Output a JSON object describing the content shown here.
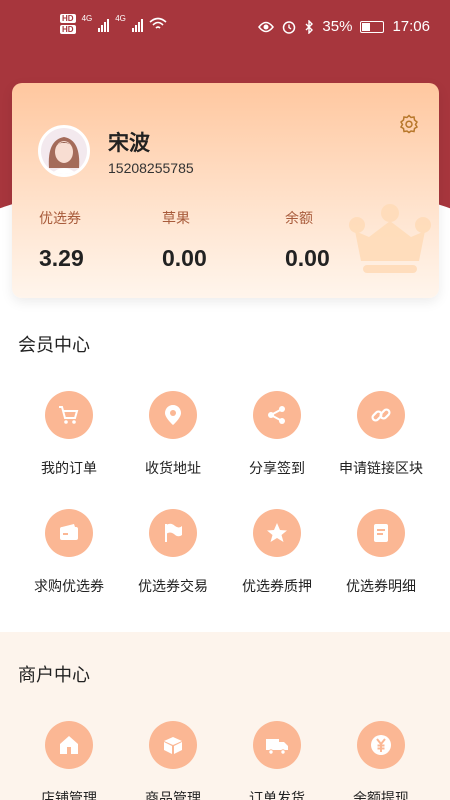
{
  "status_bar": {
    "network_badge_1": "HD",
    "network_badge_2": "HD",
    "network_type_1": "4G",
    "network_type_2": "4G",
    "battery": "35%",
    "time": "17:06"
  },
  "profile": {
    "name": "宋波",
    "phone": "15208255785",
    "stats": [
      {
        "label": "优选券",
        "value": "3.29"
      },
      {
        "label": "草果",
        "value": "0.00"
      },
      {
        "label": "余额",
        "value": "0.00"
      }
    ]
  },
  "member_center": {
    "title": "会员中心",
    "items": [
      {
        "label": "我的订单",
        "icon": "cart-icon"
      },
      {
        "label": "收货地址",
        "icon": "location-pin-icon"
      },
      {
        "label": "分享签到",
        "icon": "share-icon"
      },
      {
        "label": "申请链接区块",
        "icon": "link-icon"
      },
      {
        "label": "求购优选券",
        "icon": "wallet-icon"
      },
      {
        "label": "优选券交易",
        "icon": "flag-icon"
      },
      {
        "label": "优选券质押",
        "icon": "star-icon"
      },
      {
        "label": "优选券明细",
        "icon": "document-icon"
      }
    ]
  },
  "merchant_center": {
    "title": "商户中心",
    "items": [
      {
        "label": "店铺管理",
        "icon": "home-icon"
      },
      {
        "label": "商品管理",
        "icon": "box-icon"
      },
      {
        "label": "订单发货",
        "icon": "truck-icon"
      },
      {
        "label": "余额提现",
        "icon": "yen-icon"
      }
    ]
  },
  "colors": {
    "header": "#a7363d",
    "icon_circle": "#fbb794",
    "card_top": "#ffc79f",
    "merchant_bg": "#fdf4ec"
  }
}
